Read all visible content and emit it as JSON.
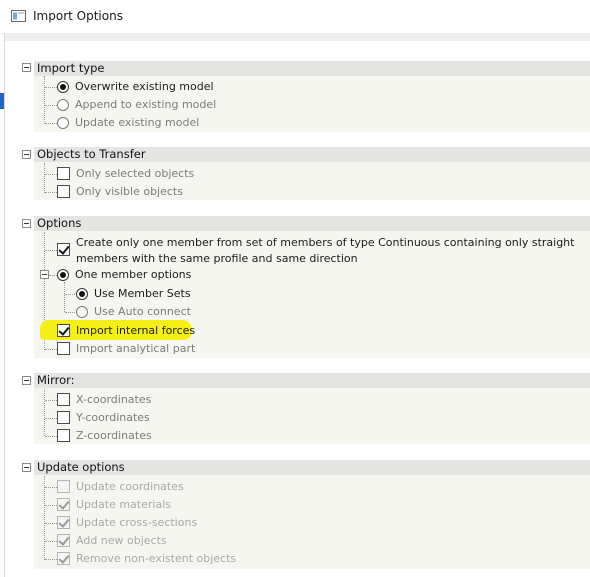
{
  "window": {
    "title": "Import Options"
  },
  "sections": {
    "import_type": {
      "title": "Import type",
      "options": [
        "Overwrite existing model",
        "Append to existing model",
        "Update existing model"
      ],
      "selected": "Overwrite existing model"
    },
    "objects": {
      "title": "Objects to Transfer",
      "items": [
        {
          "label": "Only selected objects",
          "checked": false
        },
        {
          "label": "Only visible objects",
          "checked": false
        }
      ]
    },
    "options": {
      "title": "Options",
      "continuous_member": {
        "label": "Create only one member from set of members of type Continuous containing only straight members with the same profile and same direction",
        "checked": true
      },
      "one_member_options": {
        "label": "One member options",
        "selected": true,
        "sub": [
          {
            "label": "Use Member Sets",
            "selected": true
          },
          {
            "label": "Use Auto connect",
            "selected": false
          }
        ]
      },
      "import_internal_forces": {
        "label": "Import internal forces",
        "checked": true
      },
      "import_analytical_part": {
        "label": "Import analytical part",
        "checked": false
      }
    },
    "mirror": {
      "title": "Mirror:",
      "items": [
        {
          "label": "X-coordinates",
          "checked": false
        },
        {
          "label": "Y-coordinates",
          "checked": false
        },
        {
          "label": "Z-coordinates",
          "checked": false
        }
      ]
    },
    "update_options": {
      "title": "Update options",
      "items": [
        {
          "label": "Update coordinates",
          "checked": false,
          "enabled": false
        },
        {
          "label": "Update materials",
          "checked": true,
          "enabled": false
        },
        {
          "label": "Update cross-sections",
          "checked": true,
          "enabled": false
        },
        {
          "label": "Add new objects",
          "checked": true,
          "enabled": false
        },
        {
          "label": "Remove non-existent objects",
          "checked": true,
          "enabled": false
        }
      ]
    }
  },
  "colors": {
    "highlight": "#f5ef18",
    "header_band": "#e4e4e2",
    "group_background": "#f6f6f1"
  },
  "icons": {
    "app": "window-icon",
    "collapse": "minus-square-icon"
  }
}
